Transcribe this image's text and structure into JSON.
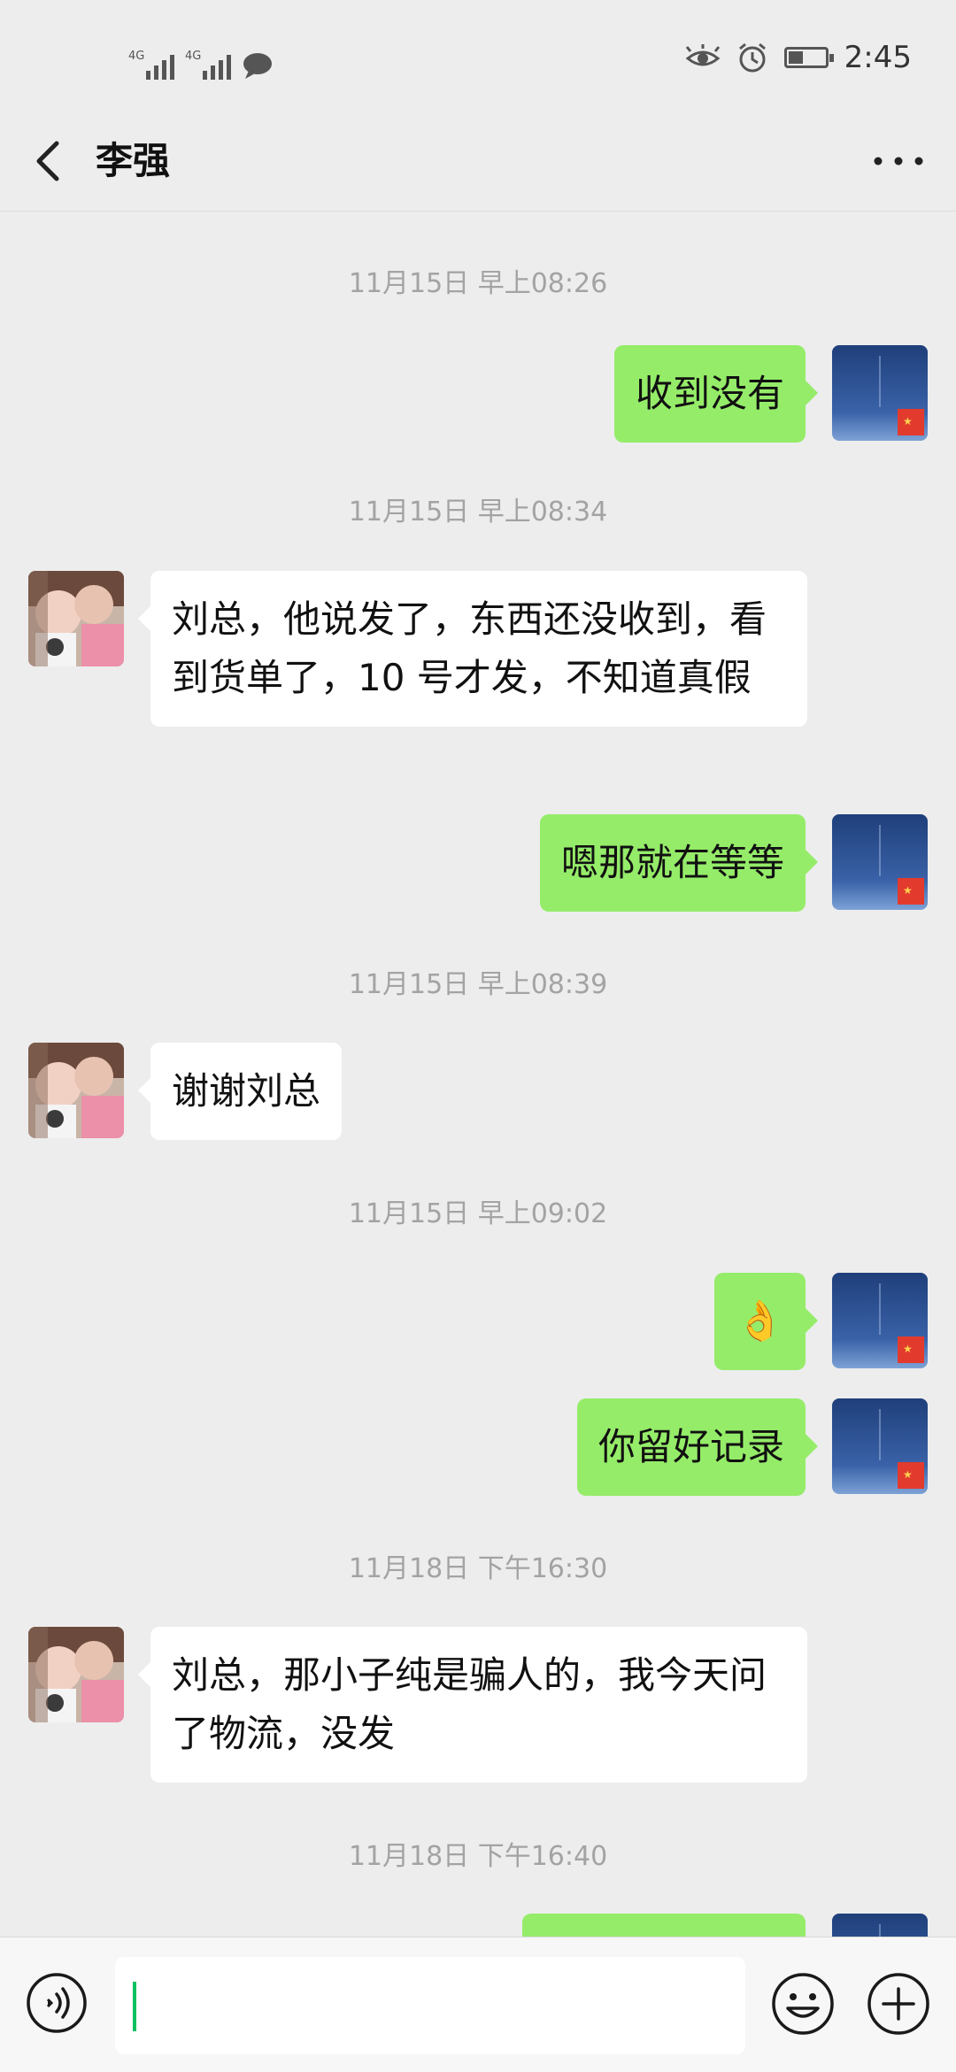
{
  "status_bar": {
    "network_1": "4G",
    "network_2": "4G",
    "time": "2:45",
    "battery_level": 0.4
  },
  "header": {
    "title": "李强"
  },
  "messages": [
    {
      "type": "timestamp",
      "text": "11月15日 早上08:26"
    },
    {
      "type": "sent",
      "text": "收到没有"
    },
    {
      "type": "timestamp",
      "text": "11月15日 早上08:34"
    },
    {
      "type": "received",
      "text": "刘总，他说发了，东西还没收到，看到货单了，10 号才发，不知道真假"
    },
    {
      "type": "sent",
      "text": "嗯那就在等等"
    },
    {
      "type": "timestamp",
      "text": "11月15日 早上08:39"
    },
    {
      "type": "received",
      "text": "谢谢刘总"
    },
    {
      "type": "timestamp",
      "text": "11月15日 早上09:02"
    },
    {
      "type": "sent",
      "text": "👌"
    },
    {
      "type": "sent",
      "text": "你留好记录"
    },
    {
      "type": "timestamp",
      "text": "11月18日 下午16:30"
    },
    {
      "type": "received",
      "text": "刘总，那小子纯是骗人的，我今天问了物流，没发"
    },
    {
      "type": "timestamp",
      "text": "11月18日 下午16:40"
    }
  ],
  "input_bar": {
    "value": ""
  },
  "icons": {
    "back": "chevron-left-icon",
    "more": "more-dots-icon",
    "voice": "voice-icon",
    "emoji": "emoji-icon",
    "plus": "plus-icon",
    "eye": "eye-icon",
    "alarm": "alarm-icon",
    "chat": "chat-bubble-icon"
  },
  "colors": {
    "sent_bubble": "#95ec69",
    "received_bubble": "#ffffff",
    "background": "#ededed",
    "caret": "#07c160"
  }
}
